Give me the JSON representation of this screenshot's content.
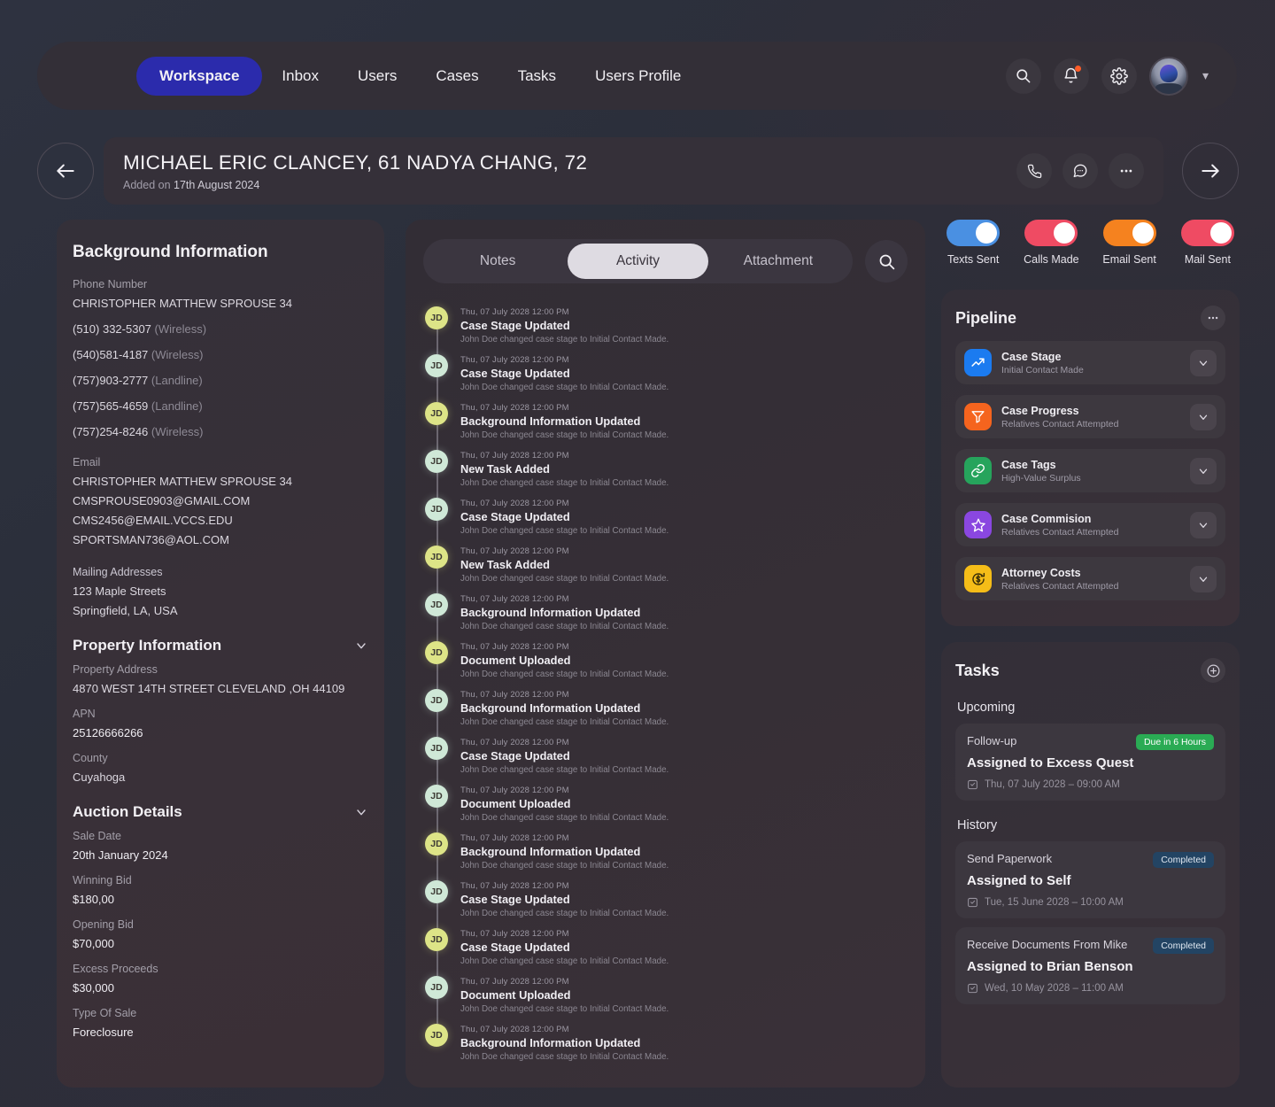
{
  "nav": {
    "items": [
      {
        "label": "Workspace",
        "active": true
      },
      {
        "label": "Inbox",
        "active": false
      },
      {
        "label": "Users",
        "active": false
      },
      {
        "label": "Cases",
        "active": false
      },
      {
        "label": "Tasks",
        "active": false
      },
      {
        "label": "Users Profile",
        "active": false
      }
    ],
    "icons": [
      "search-icon",
      "bell-icon",
      "gear-icon"
    ],
    "accent": "#2b2bac"
  },
  "titlebar": {
    "title": "MICHAEL ERIC CLANCEY, 61 NADYA CHANG, 72",
    "added_label": "Added on",
    "added_date": "17th August 2024",
    "actions": [
      "phone-icon",
      "chat-icon",
      "more-icon"
    ],
    "back": "back-arrow-icon",
    "next": "forward-arrow-icon"
  },
  "background": {
    "title": "Background Information",
    "phone_label": "Phone Number",
    "phone_owner": "CHRISTOPHER MATTHEW SPROUSE 34",
    "phones": [
      {
        "number": "(510) 332-5307",
        "kind": "(Wireless)"
      },
      {
        "number": "(540)581-4187",
        "kind": "(Wireless)"
      },
      {
        "number": "(757)903-2777",
        "kind": "(Landline)"
      },
      {
        "number": "(757)565-4659",
        "kind": "(Landline)"
      },
      {
        "number": "(757)254-8246",
        "kind": "(Wireless)"
      }
    ],
    "email_label": "Email",
    "email_owner": "CHRISTOPHER MATTHEW SPROUSE 34",
    "emails": [
      "CMSPROUSE0903@GMAIL.COM",
      "CMS2456@EMAIL.VCCS.EDU",
      "SPORTSMAN736@AOL.COM"
    ],
    "mailing_label": "Mailing Addresses",
    "mailing_line1": "123 Maple Streets",
    "mailing_line2": "Springfield, LA, USA"
  },
  "property": {
    "title": "Property Information",
    "address_label": "Property Address",
    "address_value": "4870 WEST 14TH STREET CLEVELAND ,OH 44109",
    "apn_label": "APN",
    "apn_value": "25126666266",
    "county_label": "County",
    "county_value": "Cuyahoga"
  },
  "auction": {
    "title": "Auction Details",
    "sale_date_label": "Sale Date",
    "sale_date_value": "20th January 2024",
    "winning_bid_label": "Winning Bid",
    "winning_bid_value": "$180,00",
    "opening_bid_label": "Opening Bid",
    "opening_bid_value": "$70,000",
    "excess_label": "Excess Proceeds",
    "excess_value": "$30,000",
    "type_label": "Type Of Sale",
    "type_value": "Foreclosure"
  },
  "activity": {
    "tabs": [
      {
        "label": "Notes",
        "active": false
      },
      {
        "label": "Activity",
        "active": true
      },
      {
        "label": "Attachment",
        "active": false
      }
    ],
    "search_icon": "search-icon",
    "items": [
      {
        "initials": "JD",
        "time": "Thu, 07 July 2028  12:00 PM",
        "title": "Case Stage Updated",
        "desc": "John Doe changed case stage to Initial Contact Made.",
        "color": "#dde487"
      },
      {
        "initials": "JD",
        "time": "Thu, 07 July 2028  12:00 PM",
        "title": "Case Stage Updated",
        "desc": "John Doe changed case stage to Initial Contact Made.",
        "color": "#cfe8d7"
      },
      {
        "initials": "JD",
        "time": "Thu, 07 July 2028  12:00 PM",
        "title": "Background Information Updated",
        "desc": "John Doe changed case stage to Initial Contact Made.",
        "color": "#dde487"
      },
      {
        "initials": "JD",
        "time": "Thu, 07 July 2028  12:00 PM",
        "title": "New Task Added",
        "desc": "John Doe changed case stage to Initial Contact Made.",
        "color": "#cfe8d7"
      },
      {
        "initials": "JD",
        "time": "Thu, 07 July 2028  12:00 PM",
        "title": "Case Stage Updated",
        "desc": "John Doe changed case stage to Initial Contact Made.",
        "color": "#cfe8d7"
      },
      {
        "initials": "JD",
        "time": "Thu, 07 July 2028  12:00 PM",
        "title": "New Task Added",
        "desc": "John Doe changed case stage to Initial Contact Made.",
        "color": "#dde487"
      },
      {
        "initials": "JD",
        "time": "Thu, 07 July 2028  12:00 PM",
        "title": "Background Information Updated",
        "desc": "John Doe changed case stage to Initial Contact Made.",
        "color": "#cfe8d7"
      },
      {
        "initials": "JD",
        "time": "Thu, 07 July 2028  12:00 PM",
        "title": "Document Uploaded",
        "desc": "John Doe changed case stage to Initial Contact Made.",
        "color": "#dde487"
      },
      {
        "initials": "JD",
        "time": "Thu, 07 July 2028  12:00 PM",
        "title": "Background Information Updated",
        "desc": "John Doe changed case stage to Initial Contact Made.",
        "color": "#cfe8d7"
      },
      {
        "initials": "JD",
        "time": "Thu, 07 July 2028  12:00 PM",
        "title": "Case Stage Updated",
        "desc": "John Doe changed case stage to Initial Contact Made.",
        "color": "#cfe8d7"
      },
      {
        "initials": "JD",
        "time": "Thu, 07 July 2028  12:00 PM",
        "title": "Document Uploaded",
        "desc": "John Doe changed case stage to Initial Contact Made.",
        "color": "#cfe8d7"
      },
      {
        "initials": "JD",
        "time": "Thu, 07 July 2028  12:00 PM",
        "title": "Background Information Updated",
        "desc": "John Doe changed case stage to Initial Contact Made.",
        "color": "#dde487"
      },
      {
        "initials": "JD",
        "time": "Thu, 07 July 2028  12:00 PM",
        "title": "Case Stage Updated",
        "desc": "John Doe changed case stage to Initial Contact Made.",
        "color": "#cfe8d7"
      },
      {
        "initials": "JD",
        "time": "Thu, 07 July 2028  12:00 PM",
        "title": "Case Stage Updated",
        "desc": "John Doe changed case stage to Initial Contact Made.",
        "color": "#dde487"
      },
      {
        "initials": "JD",
        "time": "Thu, 07 July 2028  12:00 PM",
        "title": "Document Uploaded",
        "desc": "John Doe changed case stage to Initial Contact Made.",
        "color": "#cfe8d7"
      },
      {
        "initials": "JD",
        "time": "Thu, 07 July 2028  12:00 PM",
        "title": "Background Information Updated",
        "desc": "John Doe changed case stage to Initial Contact Made.",
        "color": "#dde487"
      }
    ]
  },
  "toggles": [
    {
      "label": "Texts Sent",
      "on": true,
      "color": "#4a90e2"
    },
    {
      "label": "Calls Made",
      "on": true,
      "color": "#ef4b63"
    },
    {
      "label": "Email Sent",
      "on": true,
      "color": "#f5821f"
    },
    {
      "label": "Mail Sent",
      "on": true,
      "color": "#ef4b63"
    }
  ],
  "pipeline": {
    "title": "Pipeline",
    "more_icon": "more-icon",
    "rows": [
      {
        "name": "Case Stage",
        "sub": "Initial Contact Made",
        "icon": "trend-up-icon",
        "color": "#1b7bf0"
      },
      {
        "name": "Case Progress",
        "sub": "Relatives Contact Attempted",
        "icon": "funnel-icon",
        "color": "#f5641e"
      },
      {
        "name": "Case Tags",
        "sub": "High-Value Surplus",
        "icon": "link-icon",
        "color": "#26a45c"
      },
      {
        "name": "Case Commision",
        "sub": "Relatives Contact Attempted",
        "icon": "star-icon",
        "color": "#8a47e0"
      },
      {
        "name": "Attorney Costs",
        "sub": "Relatives Contact Attempted",
        "icon": "dollar-refresh-icon",
        "color": "#f5bd18"
      }
    ]
  },
  "tasks": {
    "title": "Tasks",
    "add_icon": "plus-circle-icon",
    "upcoming_label": "Upcoming",
    "history_label": "History",
    "upcoming": [
      {
        "kind": "Follow-up",
        "badge": "Due in 6 Hours",
        "badge_type": "due",
        "assign": "Assigned to Excess Quest",
        "date": "Thu, 07 July 2028  –  09:00 AM"
      }
    ],
    "history": [
      {
        "kind": "Send Paperwork",
        "badge": "Completed",
        "badge_type": "done",
        "assign": "Assigned to Self",
        "date": "Tue, 15 June 2028  –  10:00 AM"
      },
      {
        "kind": "Receive Documents From Mike",
        "badge": "Completed",
        "badge_type": "done",
        "assign": "Assigned to Brian Benson",
        "date": "Wed, 10 May 2028  –  11:00 AM"
      }
    ]
  }
}
